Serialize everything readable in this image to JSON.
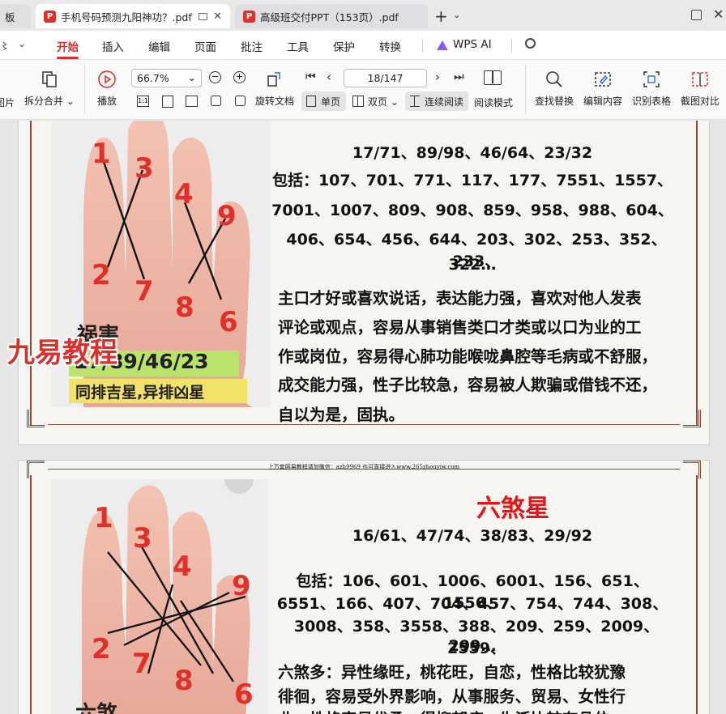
{
  "tabs": [
    {
      "label": "板",
      "active": false
    },
    {
      "label": "手机号码预测九阳神功？.pdf",
      "active": true
    },
    {
      "label": "高级班交付PPT（153页）.pdf",
      "active": false
    }
  ],
  "menu": [
    "开始",
    "插入",
    "编辑",
    "页面",
    "批注",
    "工具",
    "保护",
    "转换",
    "WPS AI"
  ],
  "toolbar": {
    "partial_left_label": "图片",
    "split_merge": "拆分合并",
    "play": "播放",
    "zoom": "66.7%",
    "rotate": "旋转文档",
    "page": "18/147",
    "single_page": "单页",
    "double_page": "双页",
    "continuous": "连续阅读",
    "read_mode": "阅读模式",
    "find_replace": "查找替换",
    "edit_content": "编辑内容",
    "recognize_table": "识别表格",
    "screenshot_compare": "截图对比"
  },
  "page1": {
    "numbers": "17/71、89/98、46/64、23/32",
    "include_1": "包括：107、701、771、117、177、7551、1557、",
    "include_2": "7001、1007、809、908、859、958、988、604、",
    "include_3": "406、654、456、644、203、302、253、352、233、",
    "include_4": "322…",
    "desc_1": "主口才好或喜欢说话，表达能力强，喜欢对他人发表",
    "desc_2": "评论或观点，容易从事销售类口才类或以口为业的工",
    "desc_3": "作或岗位，容易得心肺功能喉咙鼻腔等毛病或不舒服，",
    "desc_4": "成交能力强，性子比较急，容易被人欺骗或借钱不还，",
    "desc_5": "自以为是，固执。",
    "hand_caption_title": "祸害",
    "hand_caption_nums": "17/89/46/23",
    "hand_caption_note": "同排吉星,异排凶星",
    "watermark": "九易教程",
    "finger_nums": [
      "1",
      "3",
      "4",
      "9",
      "2",
      "7",
      "8",
      "6"
    ]
  },
  "page2": {
    "header": "上万套网易教程请加微信：azh9969   也可直接进入www.265zhouyiw.com",
    "title": "六煞星",
    "numbers": "16/61、47/74、38/83、29/92",
    "include_1": "包括：106、601、1006、6001、156、651、1556、",
    "include_2": "6551、166、407、704、457、754、744、308、",
    "include_3": "3008、358、3558、388、209、259、2009、2559、",
    "include_4": "299…",
    "desc_1": "六煞多：异性缘旺，桃花旺，自恋，性格比较犹豫",
    "desc_2": "徘徊，容易受外界影响，从事服务、贸易、女性行",
    "desc_3": "业，性格容易优柔，得抑郁症，生活比较有品位",
    "hand_caption_title": "六煞",
    "finger_nums": [
      "1",
      "3",
      "4",
      "9",
      "2",
      "7",
      "8",
      "6"
    ]
  }
}
